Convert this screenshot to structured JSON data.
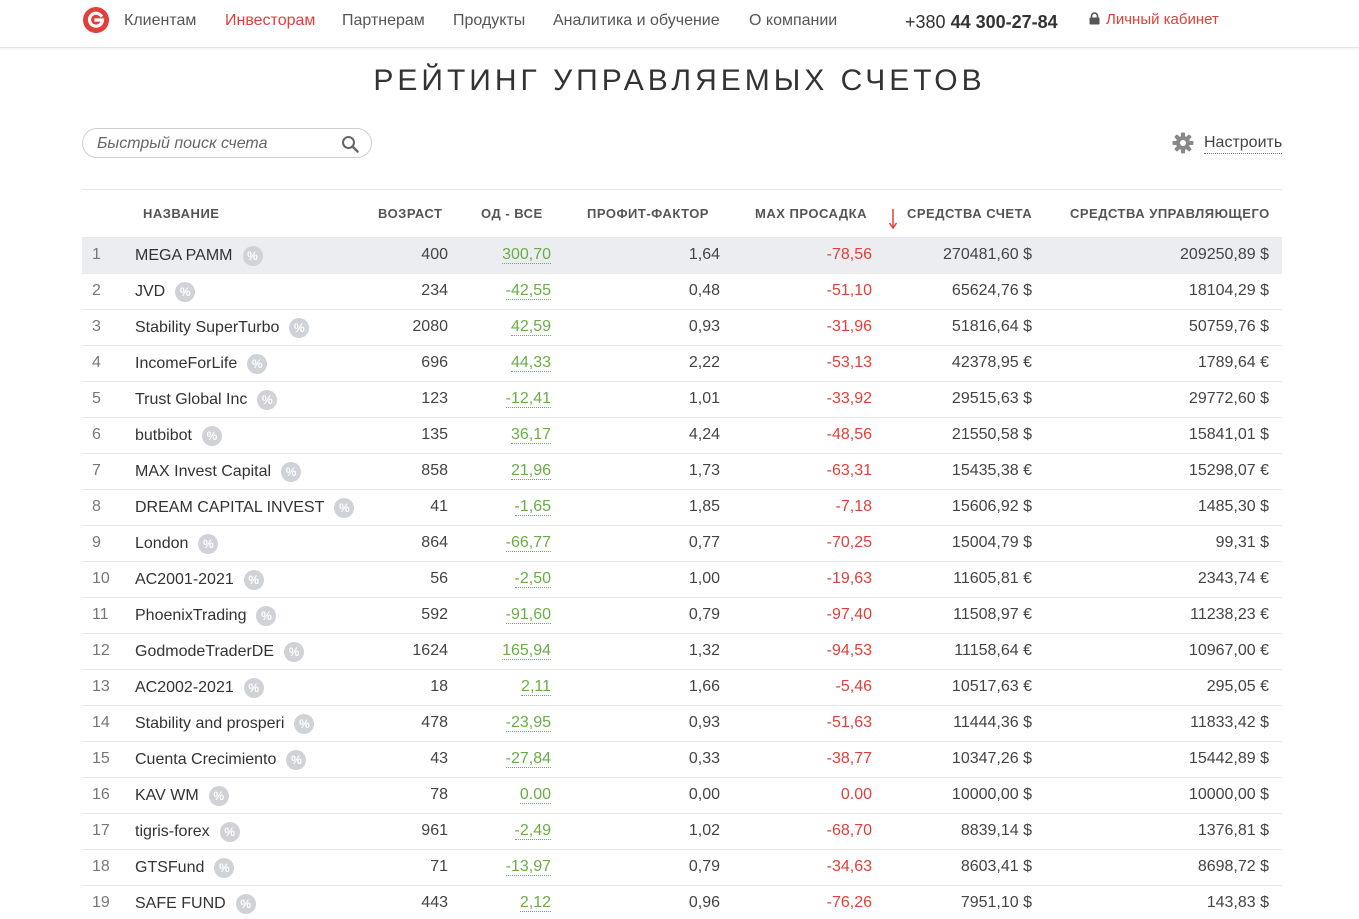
{
  "header": {
    "nav": [
      "Клиентам",
      "Инвесторам",
      "Партнерам",
      "Продукты",
      "Аналитика и обучение",
      "О компании"
    ],
    "phone_prefix": "+380",
    "phone_number": "44 300-27-84",
    "cabinet_label": "Личный кабинет",
    "brand_color": "#e0403a"
  },
  "page": {
    "title": "РЕЙТИНГ УПРАВЛЯЕМЫХ СЧЕТОВ",
    "search_placeholder": "Быстрый поиск счета",
    "settings_label": "Настроить"
  },
  "table": {
    "columns": [
      "НАЗВАНИЕ",
      "ВОЗРАСТ",
      "ОД - ВСЕ",
      "ПРОФИТ-ФАКТОР",
      "MAX ПРОСАДКА",
      "СРЕДСТВА СЧЕТА",
      "СРЕДСТВА УПРАВЛЯЮЩЕГО"
    ],
    "sorted_column": "СРЕДСТВА СЧЕТА",
    "badge": "%",
    "rows": [
      {
        "n": "1",
        "name": "MEGA PAMM",
        "age": "400",
        "od": "300,70",
        "pf": "1,64",
        "dd": "-78,56",
        "funds": "270481,60 $",
        "mgr": "209250,89 $"
      },
      {
        "n": "2",
        "name": "JVD",
        "age": "234",
        "od": "-42,55",
        "pf": "0,48",
        "dd": "-51,10",
        "funds": "65624,76 $",
        "mgr": "18104,29 $"
      },
      {
        "n": "3",
        "name": "Stability SuperTurbo",
        "age": "2080",
        "od": "42,59",
        "pf": "0,93",
        "dd": "-31,96",
        "funds": "51816,64 $",
        "mgr": "50759,76 $"
      },
      {
        "n": "4",
        "name": "IncomeForLife",
        "age": "696",
        "od": "44,33",
        "pf": "2,22",
        "dd": "-53,13",
        "funds": "42378,95 €",
        "mgr": "1789,64 €"
      },
      {
        "n": "5",
        "name": "Trust Global Inc",
        "age": "123",
        "od": "-12,41",
        "pf": "1,01",
        "dd": "-33,92",
        "funds": "29515,63 $",
        "mgr": "29772,60 $"
      },
      {
        "n": "6",
        "name": "butbibot",
        "age": "135",
        "od": "36,17",
        "pf": "4,24",
        "dd": "-48,56",
        "funds": "21550,58 $",
        "mgr": "15841,01 $"
      },
      {
        "n": "7",
        "name": "MAX Invest Capital",
        "age": "858",
        "od": "21,96",
        "pf": "1,73",
        "dd": "-63,31",
        "funds": "15435,38 €",
        "mgr": "15298,07 €"
      },
      {
        "n": "8",
        "name": "DREAM CAPITAL INVEST",
        "age": "41",
        "od": "-1,65",
        "pf": "1,85",
        "dd": "-7,18",
        "funds": "15606,92 $",
        "mgr": "1485,30 $"
      },
      {
        "n": "9",
        "name": "London",
        "age": "864",
        "od": "-66,77",
        "pf": "0,77",
        "dd": "-70,25",
        "funds": "15004,79 $",
        "mgr": "99,31 $"
      },
      {
        "n": "10",
        "name": "AC2001-2021",
        "age": "56",
        "od": "-2,50",
        "pf": "1,00",
        "dd": "-19,63",
        "funds": "11605,81 €",
        "mgr": "2343,74 €"
      },
      {
        "n": "11",
        "name": "PhoenixTrading",
        "age": "592",
        "od": "-91,60",
        "pf": "0,79",
        "dd": "-97,40",
        "funds": "11508,97 €",
        "mgr": "11238,23 €"
      },
      {
        "n": "12",
        "name": "GodmodeTraderDE",
        "age": "1624",
        "od": "165,94",
        "pf": "1,32",
        "dd": "-94,53",
        "funds": "11158,64 €",
        "mgr": "10967,00 €"
      },
      {
        "n": "13",
        "name": "AC2002-2021",
        "age": "18",
        "od": "2,11",
        "pf": "1,66",
        "dd": "-5,46",
        "funds": "10517,63 €",
        "mgr": "295,05 €"
      },
      {
        "n": "14",
        "name": "Stability and prosperi",
        "age": "478",
        "od": "-23,95",
        "pf": "0,93",
        "dd": "-51,63",
        "funds": "11444,36 $",
        "mgr": "11833,42 $"
      },
      {
        "n": "15",
        "name": "Cuenta Crecimiento",
        "age": "43",
        "od": "-27,84",
        "pf": "0,33",
        "dd": "-38,77",
        "funds": "10347,26 $",
        "mgr": "15442,89 $"
      },
      {
        "n": "16",
        "name": "KAV WM",
        "age": "78",
        "od": "0.00",
        "pf": "0,00",
        "dd": "0.00",
        "funds": "10000,00 $",
        "mgr": "10000,00 $"
      },
      {
        "n": "17",
        "name": "tigris-forex",
        "age": "961",
        "od": "-2,49",
        "pf": "1,02",
        "dd": "-68,70",
        "funds": "8839,14 $",
        "mgr": "1376,81 $"
      },
      {
        "n": "18",
        "name": "GTSFund",
        "age": "71",
        "od": "-13,97",
        "pf": "0,79",
        "dd": "-34,63",
        "funds": "8603,41 $",
        "mgr": "8698,72 $"
      },
      {
        "n": "19",
        "name": "SAFE FUND",
        "age": "443",
        "od": "2,12",
        "pf": "0,96",
        "dd": "-76,26",
        "funds": "7951,10 $",
        "mgr": "143,83 $"
      }
    ]
  }
}
